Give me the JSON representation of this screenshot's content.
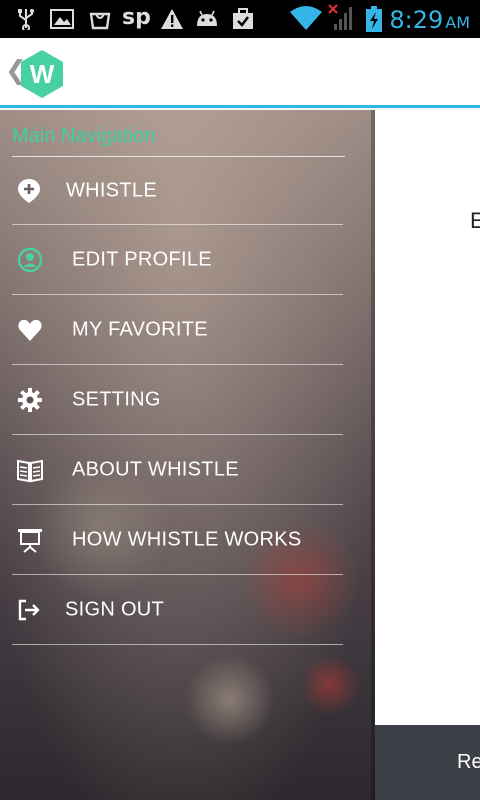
{
  "status_bar": {
    "time": "8:29",
    "ampm": "AM",
    "left_icons": [
      "usb-icon",
      "image-icon",
      "bag-icon",
      "sp-icon",
      "warning-icon",
      "android-icon",
      "briefcase-check-icon"
    ],
    "right_icons": [
      "wifi-icon",
      "signal-no-service-icon",
      "battery-charging-icon"
    ],
    "sp_text": "sp"
  },
  "action_bar": {
    "back_icon": "chevron-left-icon",
    "logo_letter": "W",
    "logo_color": "#48d1a0",
    "accent_line_color": "#33b5e5"
  },
  "main": {
    "partial_text": "E",
    "bottom_bar_text": "Re"
  },
  "drawer": {
    "header": "Main Navigation",
    "header_color": "#3fcfa0",
    "items": [
      {
        "label": "WHISTLE",
        "icon": "location-plus-icon"
      },
      {
        "label": "EDIT PROFILE",
        "icon": "user-circle-icon"
      },
      {
        "label": "MY FAVORITE",
        "icon": "heart-icon"
      },
      {
        "label": "SETTING",
        "icon": "gear-icon"
      },
      {
        "label": "ABOUT WHISTLE",
        "icon": "book-icon"
      },
      {
        "label": "HOW WHISTLE WORKS",
        "icon": "presentation-icon"
      },
      {
        "label": "SIGN OUT",
        "icon": "sign-out-icon"
      }
    ]
  }
}
